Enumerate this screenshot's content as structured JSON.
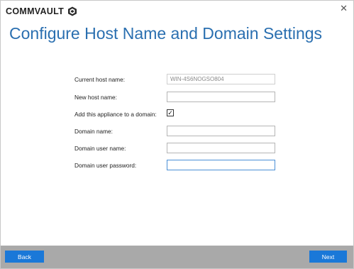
{
  "brand": {
    "name": "COMMVAULT",
    "logo_icon": "commvault-logo-icon"
  },
  "window": {
    "close_glyph": "✕"
  },
  "page_title": "Configure Host Name and Domain Settings",
  "form": {
    "current_host": {
      "label": "Current host name:",
      "value": "WIN-4S6NOGSO804"
    },
    "new_host": {
      "label": "New host name:",
      "value": ""
    },
    "add_domain": {
      "label": "Add this appliance to a domain:",
      "checked": true,
      "glyph": "✓"
    },
    "domain_name": {
      "label": "Domain name:",
      "value": ""
    },
    "domain_user": {
      "label": "Domain user name:",
      "value": ""
    },
    "domain_password": {
      "label": "Domain user password:",
      "value": ""
    }
  },
  "footer": {
    "back_label": "Back",
    "next_label": "Next"
  },
  "colors": {
    "accent": "#1a78d8",
    "title": "#2a6fb0",
    "footer_bg": "#a9a9a9"
  }
}
